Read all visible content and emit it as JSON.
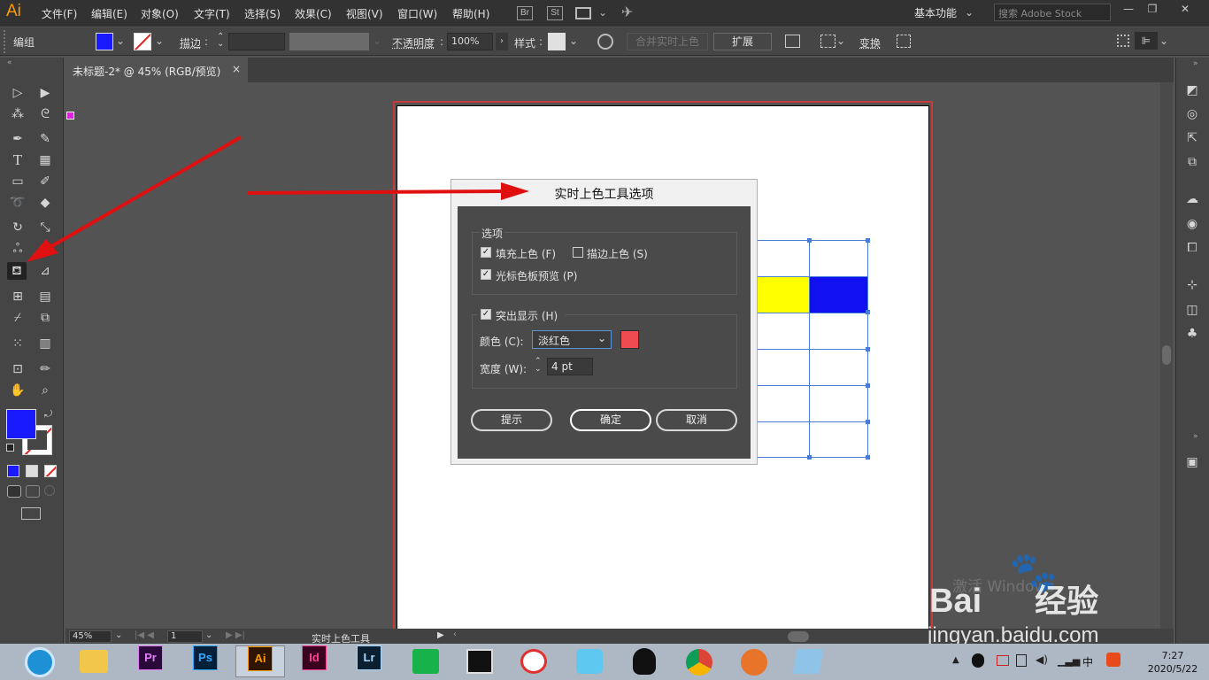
{
  "app": {
    "logo": "Ai"
  },
  "menubar": {
    "items": [
      "文件(F)",
      "编辑(E)",
      "对象(O)",
      "文字(T)",
      "选择(S)",
      "效果(C)",
      "视图(V)",
      "窗口(W)",
      "帮助(H)"
    ],
    "bridge_label": "Br",
    "stock_label": "St",
    "workspace": "基本功能",
    "search_placeholder": "搜索 Adobe Stock",
    "window_controls": [
      "—",
      "❐",
      "✕"
    ]
  },
  "controlbar": {
    "selection_label": "编组",
    "stroke_label": "描边",
    "opacity_label": "不透明度",
    "opacity_value": "100%",
    "style_label": "样式",
    "merge_live_paint": "合并实时上色",
    "expand": "扩展",
    "transform": "变换"
  },
  "document": {
    "tab_title": "未标题-2* @ 45% (RGB/预览)",
    "close": "×"
  },
  "dialog": {
    "title": "实时上色工具选项",
    "options_legend": "选项",
    "fill_paint": "填充上色 (F)",
    "stroke_paint": "描边上色 (S)",
    "cursor_swatch_preview": "光标色板预览 (P)",
    "highlight": "突出显示 (H)",
    "color_label": "颜色 (C):",
    "color_value": "淡红色",
    "width_label": "宽度 (W):",
    "width_value": "4 pt",
    "tips_button": "提示",
    "ok_button": "确定",
    "cancel_button": "取消",
    "checked": {
      "fill": true,
      "stroke": false,
      "preview": true,
      "highlight": true
    }
  },
  "statusbar": {
    "zoom": "45%",
    "page": "1",
    "tool_name": "实时上色工具"
  },
  "colors": {
    "fill": "#1a1aff",
    "highlight_color": "#f04b50",
    "cell_yellow": "#ffff00",
    "cell_blue": "#1010f0",
    "taskbar_icons": [
      "ie",
      "explorer",
      "premiere",
      "photoshop",
      "illustrator",
      "indesign",
      "lightroom",
      "green-app",
      "video-app",
      "red-app",
      "cloud-app",
      "qq",
      "chrome",
      "firefox-app",
      "blue-app"
    ]
  },
  "taskbar": {
    "apps": [
      "Pr",
      "Ps",
      "Ai",
      "Id",
      "Lr"
    ],
    "ime": "中",
    "time": "7:27",
    "date": "2020/5/22"
  },
  "watermark": {
    "activate_text": "激活 Windows",
    "baidu": "Bai",
    "jingyan": "经验",
    "site": "jingyan.baidu.com"
  }
}
